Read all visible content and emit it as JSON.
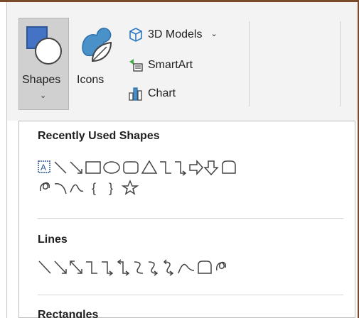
{
  "ribbon": {
    "shapes_label": "Shapes",
    "icons_label": "Icons",
    "models_label": "3D Models",
    "smartart_label": "SmartArt",
    "chart_label": "Chart",
    "caret": "⌄",
    "models_caret": "⌄"
  },
  "gallery": {
    "recent_heading": "Recently Used Shapes",
    "lines_heading": "Lines",
    "rectangles_heading": "Rectangles",
    "brace_open": "{",
    "brace_close": "}"
  },
  "colors": {
    "accent": "#2b579a",
    "frame": "#7a4a2a"
  }
}
